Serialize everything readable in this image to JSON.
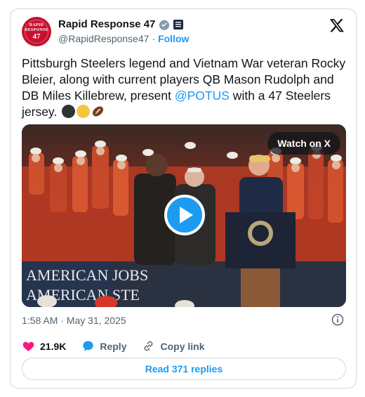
{
  "account": {
    "display_name": "Rapid Response 47",
    "handle": "@RapidResponse47",
    "separator": "·",
    "follow_label": "Follow",
    "avatar_text": [
      "RAPID",
      "RESPONSE",
      "47"
    ]
  },
  "tweet": {
    "text_before": "Pittsburgh Steelers legend and Vietnam War veteran Rocky Bleier, along with current players QB Mason Rudolph and DB Miles Killebrew, present ",
    "mention": "@POTUS",
    "text_after": " with a 47 Steelers jersey.",
    "emojis": [
      "black-circle",
      "yellow-circle",
      "football"
    ]
  },
  "media": {
    "watch_label": "Watch on X",
    "banner_line1": "AMERICAN JOBS",
    "banner_line2": "AMERICAN STE"
  },
  "timestamp": "1:58 AM · May 31, 2025",
  "actions": {
    "likes_count": "21.9K",
    "reply_label": "Reply",
    "copy_link_label": "Copy link"
  },
  "read_replies_label": "Read 371 replies",
  "colors": {
    "accent": "#1d9bf0",
    "like": "#f91880",
    "text": "#0f1419",
    "muted": "#536471",
    "border": "#cfd9de"
  }
}
